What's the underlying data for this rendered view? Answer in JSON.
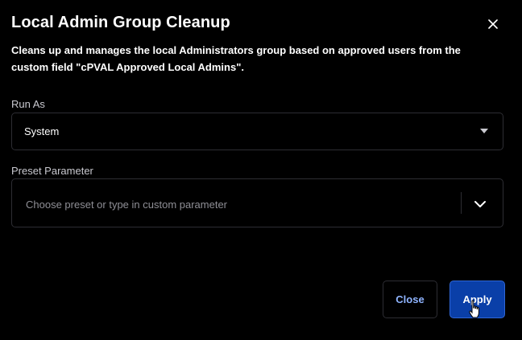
{
  "dialog": {
    "title": "Local Admin Group Cleanup",
    "description": "Cleans up and manages the local Administrators group based on approved users from the custom field \"cPVAL Approved Local Admins\"."
  },
  "run_as": {
    "label": "Run As",
    "value": "System"
  },
  "preset_parameter": {
    "label": "Preset Parameter",
    "placeholder": "Choose preset or type in custom parameter"
  },
  "buttons": {
    "close": "Close",
    "apply": "Apply"
  },
  "icons": {
    "dialog_close": "close-icon",
    "run_as_dropdown": "caret-down-icon",
    "preset_dropdown": "chevron-down-icon",
    "cursor": "hand-pointer-cursor"
  },
  "colors": {
    "background": "#000000",
    "border": "#2d2d33",
    "primary": "#0a3fa8",
    "link": "#8fb4ff"
  }
}
